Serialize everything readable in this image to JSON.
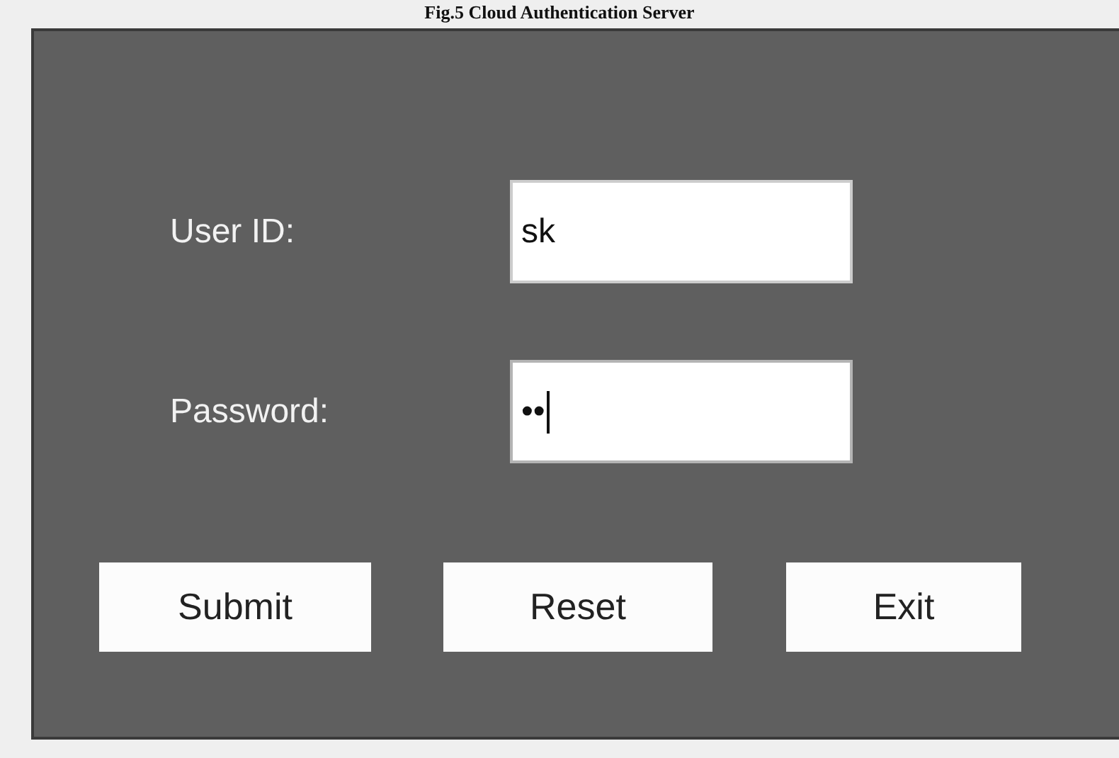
{
  "caption": "Fig.5 Cloud Authentication Server",
  "fields": [
    {
      "label": "User ID:",
      "value": "sk",
      "focused": false
    },
    {
      "label": "Password:",
      "value": "••",
      "focused": true
    }
  ],
  "buttons": [
    "Submit",
    "Reset",
    "Exit"
  ]
}
